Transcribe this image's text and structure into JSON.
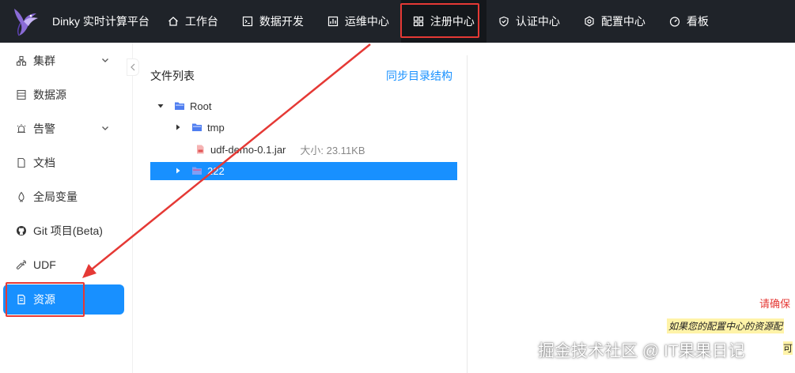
{
  "header": {
    "brand": "Dinky 实时计算平台",
    "nav": [
      {
        "label": "工作台",
        "icon": "home-icon"
      },
      {
        "label": "数据开发",
        "icon": "code-icon"
      },
      {
        "label": "运维中心",
        "icon": "ops-icon"
      },
      {
        "label": "注册中心",
        "icon": "grid-icon",
        "active": true
      },
      {
        "label": "认证中心",
        "icon": "shield-icon"
      },
      {
        "label": "配置中心",
        "icon": "gear-icon"
      },
      {
        "label": "看板",
        "icon": "dashboard-icon"
      }
    ]
  },
  "sidebar": {
    "items": [
      {
        "label": "集群",
        "icon": "cluster-icon",
        "expandable": true
      },
      {
        "label": "数据源",
        "icon": "database-icon"
      },
      {
        "label": "告警",
        "icon": "alarm-icon",
        "expandable": true
      },
      {
        "label": "文档",
        "icon": "document-icon"
      },
      {
        "label": "全局变量",
        "icon": "variable-icon"
      },
      {
        "label": "Git 项目(Beta)",
        "icon": "github-icon"
      },
      {
        "label": "UDF",
        "icon": "wrench-icon"
      },
      {
        "label": "资源",
        "icon": "file-icon",
        "active": true
      }
    ]
  },
  "main": {
    "title": "文件列表",
    "sync_label": "同步目录结构",
    "tree": [
      {
        "name": "Root",
        "type": "folder",
        "expanded": true
      },
      {
        "name": "tmp",
        "type": "folder",
        "expanded": false
      },
      {
        "name": "udf-demo-0.1.jar",
        "type": "jar",
        "size": "大小: 23.11KB"
      },
      {
        "name": "222",
        "type": "folder",
        "expanded": false,
        "selected": true
      }
    ]
  },
  "detail": {
    "confirm": "请确保",
    "note": "如果您的配置中心的资源配",
    "note2": "可"
  },
  "watermark": "掘金技术社区 @ IT果果日记",
  "colors": {
    "header_bg": "#1f2329",
    "accent": "#1890ff",
    "annotation": "#e53935",
    "highlight": "#fff3a8"
  }
}
